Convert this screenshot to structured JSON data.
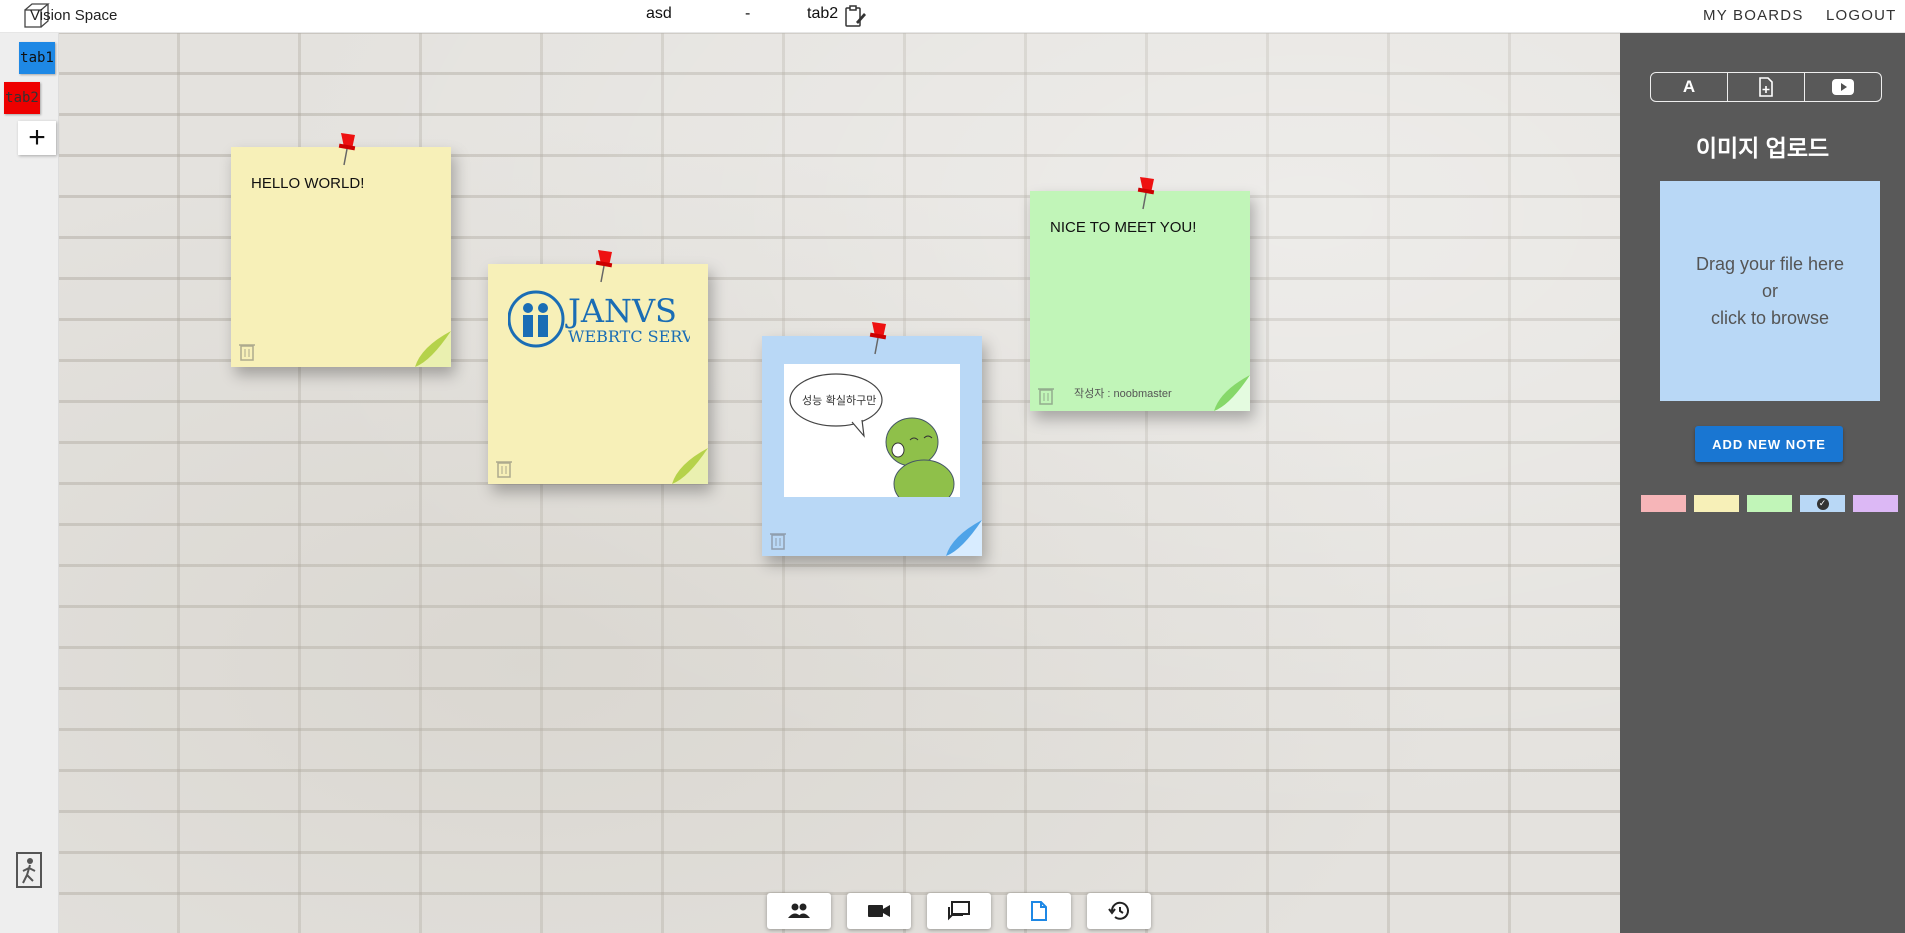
{
  "header": {
    "app_title": "Vision Space",
    "board_name": "asd",
    "separator": "-",
    "tab_name": "tab2",
    "nav": {
      "my_boards": "MY BOARDS",
      "logout": "LOGOUT"
    }
  },
  "sidebar": {
    "tabs": [
      {
        "label": "tab1",
        "color": "#1e88e5"
      },
      {
        "label": "tab2",
        "color": "#ee0000"
      }
    ],
    "add_label": "+"
  },
  "notes": [
    {
      "color": "yellow",
      "text": "HELLO WORLD!"
    },
    {
      "color": "yellow",
      "text": "",
      "logo": {
        "title": "JANVS",
        "subtitle": "WEBRTC SERVER"
      }
    },
    {
      "color": "blue",
      "text": "",
      "comic_caption": "성능 확실하구만"
    },
    {
      "color": "green",
      "text": "NICE TO MEET YOU!",
      "author": "작성자 : noobmaster"
    }
  ],
  "panel": {
    "tools": [
      "A",
      "file-add-icon",
      "youtube-icon"
    ],
    "title": "이미지 업로드",
    "dropzone_text": "Drag your file here\nor\nclick to browse",
    "add_button": "ADD NEW NOTE",
    "swatches": [
      "#f6b5b8",
      "#f7f0b8",
      "#c1f5b8",
      "#b9d8f6",
      "#dcb8f5"
    ],
    "selected_swatch": 3
  },
  "dock": {
    "buttons": [
      "people-icon",
      "video-icon",
      "chat-icon",
      "note-icon",
      "history-icon"
    ],
    "active_index": 3
  }
}
